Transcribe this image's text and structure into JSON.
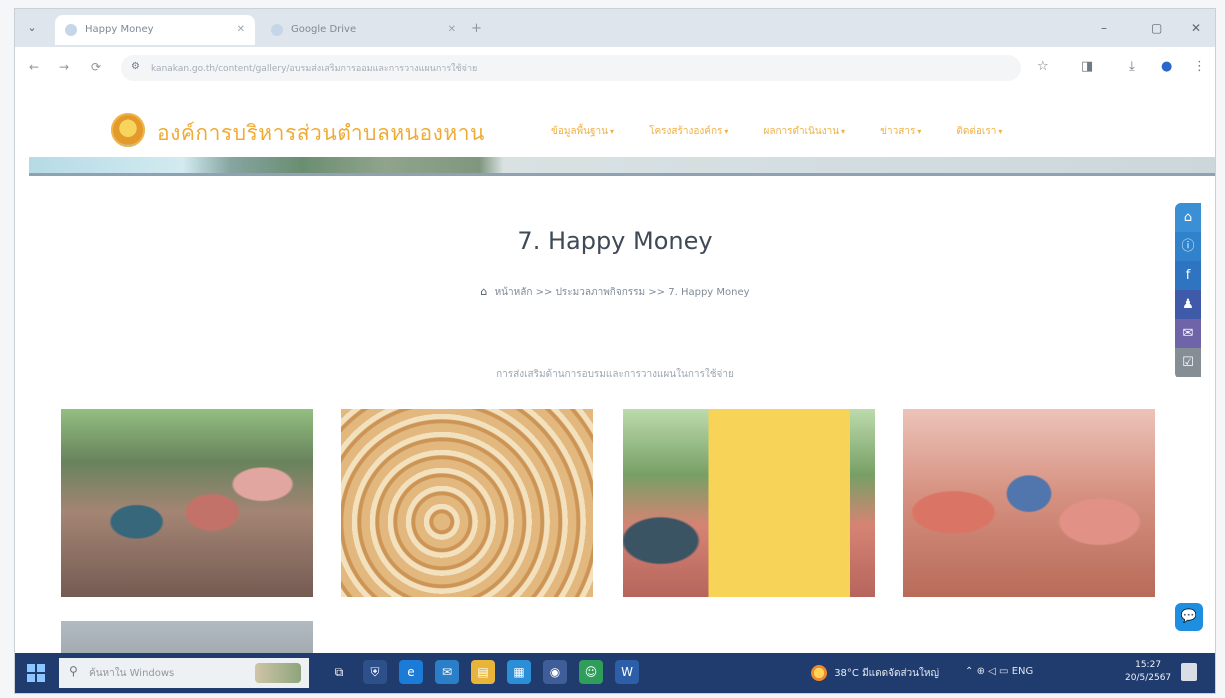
{
  "browser": {
    "tabs": [
      {
        "label": "Happy Money",
        "active": true
      },
      {
        "label": "Google Drive",
        "active": false
      }
    ],
    "new_tab": "+",
    "window_controls": {
      "minimize": "–",
      "maximize": "▢",
      "close": "✕"
    },
    "nav": {
      "back": "←",
      "forward": "→",
      "reload": "⟳"
    },
    "url": "kanakan.go.th/content/gallery/อบรมส่งเสริมการออมและการวางแผนการใช้จ่าย",
    "tool_icons": [
      "star-icon",
      "extensions-icon",
      "download-icon",
      "profile-icon",
      "menu-icon"
    ]
  },
  "site": {
    "title": "องค์การบริหารส่วนตำบลหนองหาน",
    "nav": [
      {
        "label": "ข้อมูลพื้นฐาน"
      },
      {
        "label": "โครงสร้างองค์กร"
      },
      {
        "label": "ผลการดำเนินงาน"
      },
      {
        "label": "ข่าวสาร"
      },
      {
        "label": "ติดต่อเรา"
      }
    ]
  },
  "page": {
    "title": "7. Happy Money",
    "breadcrumb": {
      "home": "หน้าหลัก",
      "separator": ">>",
      "section": "ประมวลภาพกิจกรรม",
      "current": "7. Happy Money"
    },
    "album_description": "การส่งเสริมด้านการอบรมและการวางแผนในการใช้จ่าย",
    "photos": [
      {
        "name": "photo-1"
      },
      {
        "name": "photo-2"
      },
      {
        "name": "photo-3"
      },
      {
        "name": "photo-4"
      },
      {
        "name": "photo-5"
      }
    ]
  },
  "side_bar": [
    "home-icon",
    "info-icon",
    "facebook-icon",
    "user-icon",
    "mail-icon",
    "checklist-icon"
  ],
  "chat_button": "chat-icon",
  "taskbar": {
    "search_placeholder": "ค้นหาใน Windows",
    "weather": "38°C มีแดดจัดส่วนใหญ่",
    "language": "ENG",
    "time": "15:27",
    "date": "20/5/2567"
  },
  "colors": {
    "brand_orange": "#f0ab35",
    "title_text": "#3f4a56",
    "taskbar": "#203b6e"
  }
}
